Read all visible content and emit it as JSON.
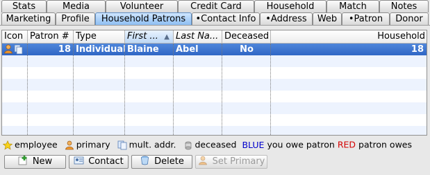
{
  "tabs_row1": [
    "Stats",
    "Media",
    "Volunteer",
    "Credit Card",
    "Household",
    "Match",
    "Notes"
  ],
  "tabs_row2": [
    "Marketing",
    "Profile",
    "Household Patrons",
    "•Contact Info",
    "•Address",
    "Web",
    "•Patron",
    "Donor"
  ],
  "active_tab": "Household Patrons",
  "grid": {
    "columns": [
      "Icon",
      "Patron #",
      "Type",
      "First ...",
      "Last Na...",
      "Deceased",
      "Household"
    ],
    "sorted_column": "First ...",
    "rows": [
      {
        "patron_no": "18",
        "type": "Individual",
        "first": "Blaine",
        "last": "Abel",
        "deceased": "No",
        "household": "18",
        "icons": [
          "primary-person-icon",
          "mult-addr-icon"
        ],
        "selected": true
      }
    ]
  },
  "legend": {
    "employee": "employee",
    "primary": "primary",
    "mult_addr": "mult. addr.",
    "deceased": "deceased",
    "blue_word": "BLUE",
    "blue_text": "you owe patron",
    "red_word": "RED",
    "red_text": "patron owes",
    "blue_color": "#0000cc",
    "red_color": "#d40000"
  },
  "buttons": {
    "new": "New",
    "contact": "Contact",
    "delete": "Delete",
    "set_primary": "Set Primary"
  }
}
